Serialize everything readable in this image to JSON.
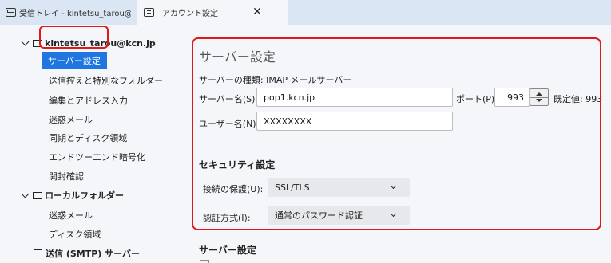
{
  "tabs": [
    {
      "label": "受信トレイ - kintetsu_tarou@kcn",
      "icon": "inbox-icon"
    },
    {
      "label": "アカウント設定",
      "icon": "settings-tab-icon",
      "close": "✕"
    }
  ],
  "sidebar": {
    "account": "kintetsu_tarou@kcn.jp",
    "account_items": [
      "サーバー設定",
      "送信控えと特別なフォルダー",
      "編集とアドレス入力",
      "迷惑メール",
      "同期とディスク領域",
      "エンドツーエンド暗号化",
      "開封確認"
    ],
    "local_folders": "ローカルフォルダー",
    "local_items": [
      "迷惑メール",
      "ディスク領域"
    ],
    "smtp": "送信 (SMTP) サーバー"
  },
  "main": {
    "heading": "サーバー設定",
    "server_type": "サーバーの種類: IMAP メールサーバー",
    "server_name_label": "サーバー名(S):",
    "server_name_value": "pop1.kcn.jp",
    "port_label": "ポート(P):",
    "port_value": "993",
    "default_label": "既定値: 993",
    "username_label": "ユーザー名(N):",
    "username_value": "XXXXXXXX",
    "security_heading": "セキュリティ設定",
    "connection_security_label": "接続の保護(U):",
    "connection_security_value": "SSL/TLS",
    "auth_label": "認証方式(I):",
    "auth_value": "通常のパスワード認証",
    "server_settings_heading2": "サーバー設定"
  },
  "colors": {
    "accent": "#1f76e0",
    "highlight_border": "#e01818",
    "tabbar_bg": "#dae6f3",
    "panel_bg": "#f4f6f9"
  }
}
